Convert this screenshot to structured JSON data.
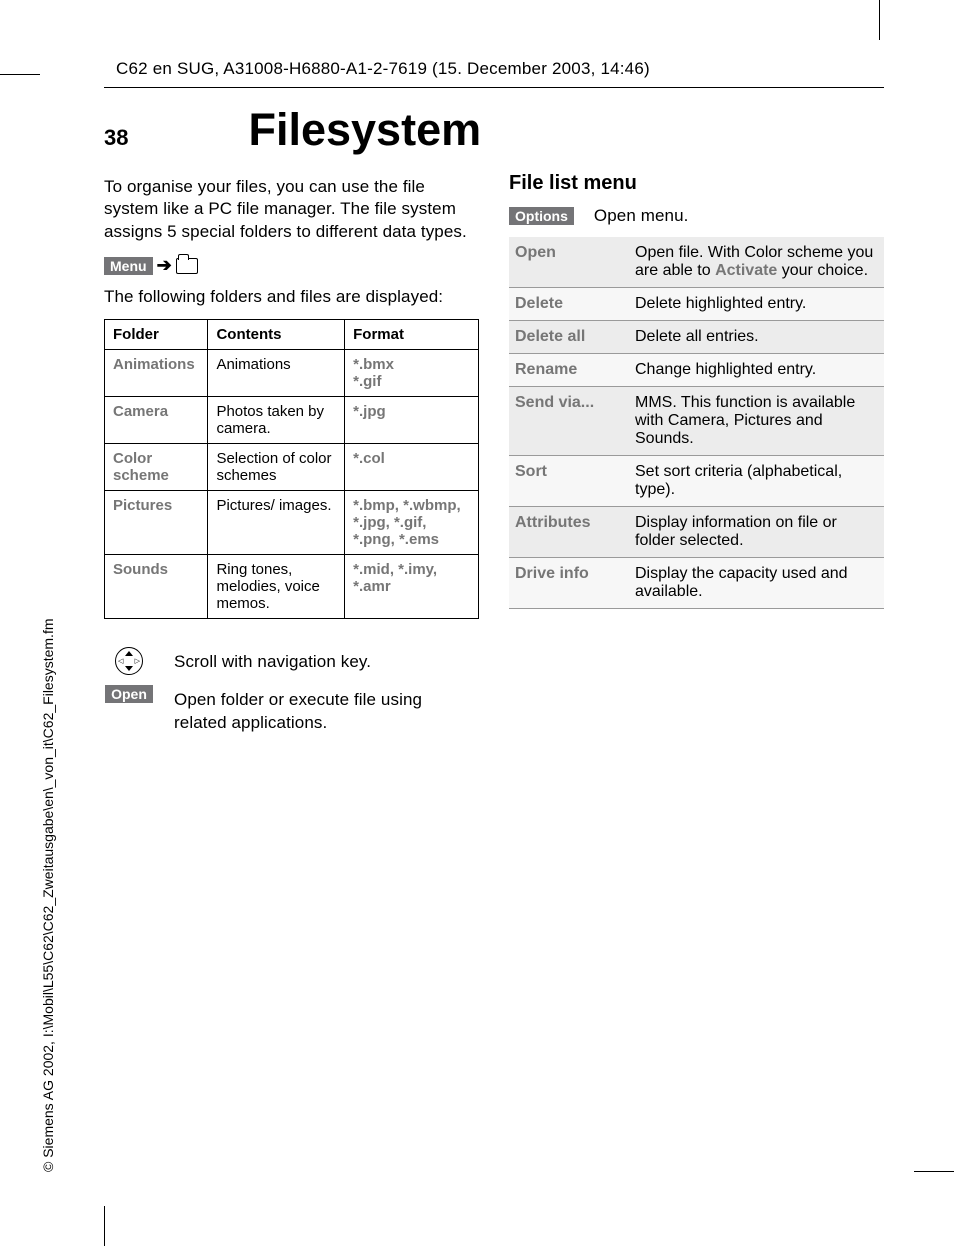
{
  "header": "C62 en SUG, A31008-H6880-A1-2-7619 (15. December 2003, 14:46)",
  "page_number": "38",
  "title": "Filesystem",
  "side": "© Siemens AG 2002, I:\\Mobil\\L55\\C62\\C62_Zweitausgabe\\en\\_von_it\\C62_Filesystem.fm",
  "left": {
    "intro": "To organise your files, you can use the file system like a PC file manager. The file system assigns 5 special folders to different data types.",
    "menu_label": "Menu",
    "after_menu": "The following folders and files are displayed:",
    "table_header": {
      "c1": "Folder",
      "c2": "Contents",
      "c3": "Format"
    },
    "rows": [
      {
        "folder": "Animations",
        "contents": "Animations",
        "format": "*.bmx\n*.gif"
      },
      {
        "folder": "Camera",
        "contents": "Photos taken by camera.",
        "format": "*.jpg"
      },
      {
        "folder": "Color scheme",
        "contents": "Selection of color schemes",
        "format": "*.col"
      },
      {
        "folder": "Pictures",
        "contents": "Pictures/ images.",
        "format": "*.bmp, *.wbmp, *.jpg, *.gif, *.png, *.ems"
      },
      {
        "folder": "Sounds",
        "contents": "Ring tones, melodies, voice memos.",
        "format": "*.mid, *.imy, *.amr"
      }
    ],
    "nav_text": "Scroll with navigation key.",
    "open_label": "Open",
    "open_text": "Open folder or execute file using related applications."
  },
  "right": {
    "heading": "File list menu",
    "options_label": "Options",
    "options_text": "Open menu.",
    "menu": [
      {
        "label": "Open",
        "desc_pre": "Open file. With Color scheme you are able to ",
        "desc_bold": "Activate",
        "desc_post": " your choice."
      },
      {
        "label": "Delete",
        "desc": "Delete highlighted entry."
      },
      {
        "label": "Delete all",
        "desc": "Delete all entries."
      },
      {
        "label": "Rename",
        "desc": "Change highlighted entry."
      },
      {
        "label": "Send via...",
        "desc": "MMS. This function is available with Camera, Pictures and Sounds."
      },
      {
        "label": "Sort",
        "desc": "Set sort criteria (alphabetical, type)."
      },
      {
        "label": "Attributes",
        "desc": "Display information on file or folder selected."
      },
      {
        "label": "Drive info",
        "desc": "Display the capacity used and available."
      }
    ]
  }
}
